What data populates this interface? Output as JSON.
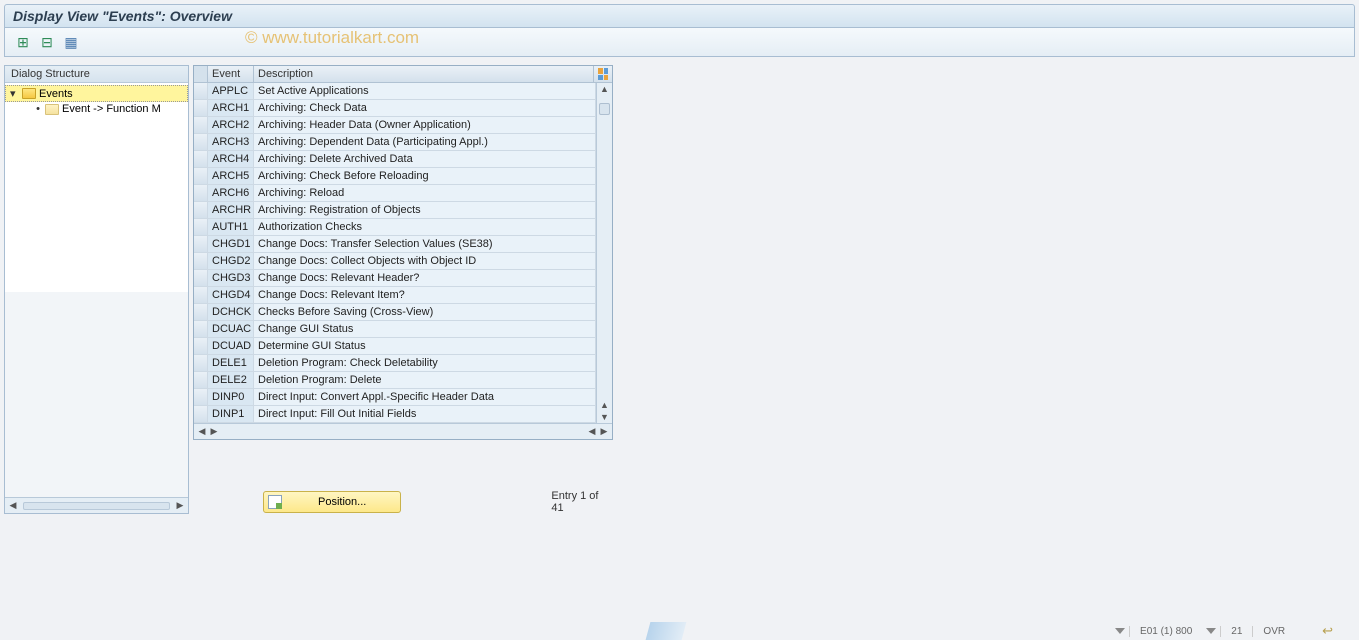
{
  "title": "Display View \"Events\": Overview",
  "watermark": "© www.tutorialkart.com",
  "tree": {
    "header": "Dialog Structure",
    "root": {
      "label": "Events"
    },
    "child": {
      "label": "Event -> Function M"
    }
  },
  "table": {
    "columns": {
      "event": "Event",
      "description": "Description"
    },
    "rows": [
      {
        "event": "APPLC",
        "desc": "Set Active Applications"
      },
      {
        "event": "ARCH1",
        "desc": "Archiving: Check Data"
      },
      {
        "event": "ARCH2",
        "desc": "Archiving: Header Data (Owner Application)"
      },
      {
        "event": "ARCH3",
        "desc": "Archiving: Dependent Data (Participating Appl.)"
      },
      {
        "event": "ARCH4",
        "desc": "Archiving: Delete Archived Data"
      },
      {
        "event": "ARCH5",
        "desc": "Archiving: Check Before Reloading"
      },
      {
        "event": "ARCH6",
        "desc": "Archiving: Reload"
      },
      {
        "event": "ARCHR",
        "desc": "Archiving: Registration of Objects"
      },
      {
        "event": "AUTH1",
        "desc": "Authorization Checks"
      },
      {
        "event": "CHGD1",
        "desc": "Change Docs: Transfer Selection Values (SE38)"
      },
      {
        "event": "CHGD2",
        "desc": "Change Docs: Collect Objects with Object ID"
      },
      {
        "event": "CHGD3",
        "desc": "Change Docs: Relevant Header?"
      },
      {
        "event": "CHGD4",
        "desc": "Change Docs: Relevant Item?"
      },
      {
        "event": "DCHCK",
        "desc": "Checks Before Saving (Cross-View)"
      },
      {
        "event": "DCUAC",
        "desc": "Change GUI Status"
      },
      {
        "event": "DCUAD",
        "desc": "Determine GUI Status"
      },
      {
        "event": "DELE1",
        "desc": "Deletion Program: Check Deletability"
      },
      {
        "event": "DELE2",
        "desc": "Deletion Program: Delete"
      },
      {
        "event": "DINP0",
        "desc": "Direct Input: Convert Appl.-Specific Header Data"
      },
      {
        "event": "DINP1",
        "desc": "Direct Input: Fill Out Initial Fields"
      }
    ]
  },
  "footer": {
    "position_label": "Position...",
    "entry_text": "Entry 1 of 41"
  },
  "status": {
    "system": "E01 (1) 800",
    "col": "21",
    "mode": "OVR"
  }
}
